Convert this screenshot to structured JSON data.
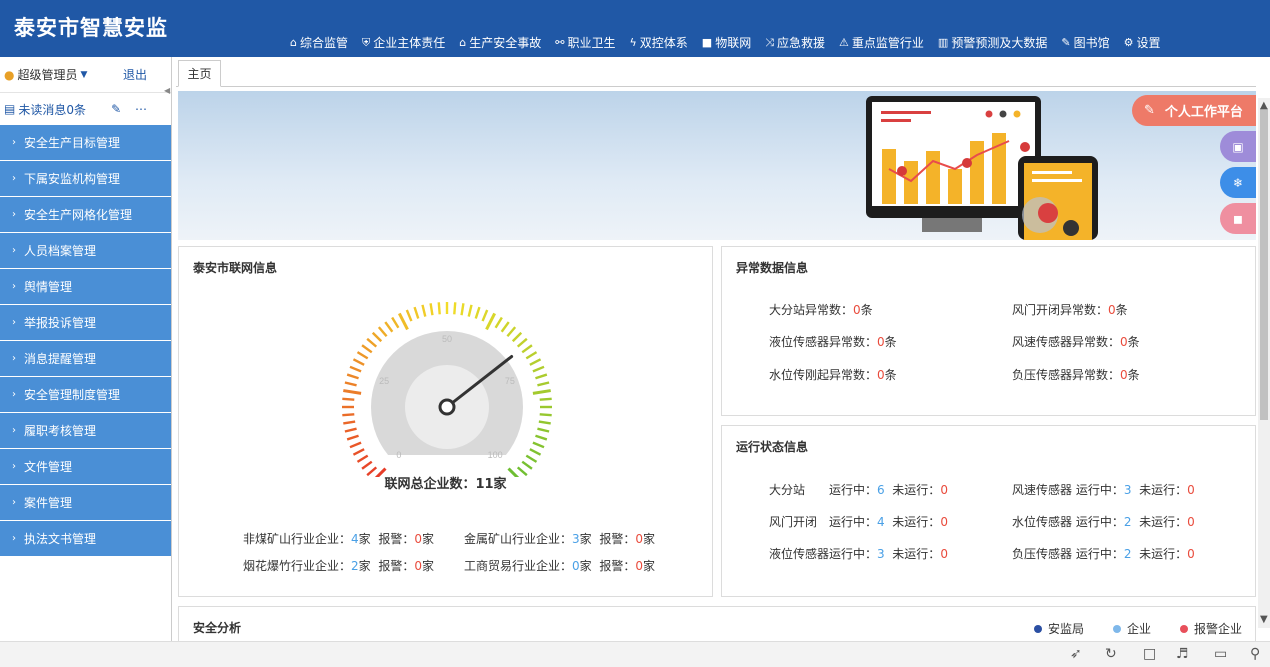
{
  "app": {
    "title": "泰安市智慧安监"
  },
  "nav": [
    {
      "icon": "home-icon",
      "glyph": "⌂",
      "label": "综合监管"
    },
    {
      "icon": "shield-icon",
      "glyph": "⛨",
      "label": "企业主体责任"
    },
    {
      "icon": "bank-icon",
      "glyph": "⌂",
      "label": "生产安全事故"
    },
    {
      "icon": "sitemap-icon",
      "glyph": "⚯",
      "label": "职业卫生"
    },
    {
      "icon": "bolt-icon",
      "glyph": "ϟ",
      "label": "双控体系"
    },
    {
      "icon": "camera-icon",
      "glyph": "■",
      "label": "物联网"
    },
    {
      "icon": "shuffle-icon",
      "glyph": "⤨",
      "label": "应急救援"
    },
    {
      "icon": "warning-icon",
      "glyph": "⚠",
      "label": "重点监管行业"
    },
    {
      "icon": "bar-chart-icon",
      "glyph": "▥",
      "label": "预警预测及大数据"
    },
    {
      "icon": "wrench-icon",
      "glyph": "✎",
      "label": "图书馆"
    },
    {
      "icon": "gear-icon",
      "glyph": "⚙",
      "label": "设置"
    }
  ],
  "sidebar": {
    "user": "超级管理员",
    "logout": "退出",
    "unread": "未读消息0条",
    "items": [
      "安全生产目标管理",
      "下属安监机构管理",
      "安全生产网格化管理",
      "人员档案管理",
      "舆情管理",
      "举报投诉管理",
      "消息提醒管理",
      "安全管理制度管理",
      "履职考核管理",
      "文件管理",
      "案件管理",
      "执法文书管理"
    ]
  },
  "tabs": {
    "home": "主页"
  },
  "float": {
    "workbench": "个人工作平台"
  },
  "network": {
    "title": "泰安市联网信息",
    "gauge": {
      "value": 11,
      "min": 0,
      "max": 100,
      "ticks": [
        "0",
        "25",
        "50",
        "75",
        "100"
      ]
    },
    "total_label": "联网总企业数：11家",
    "rows": [
      {
        "label": "非煤矿山行业企业：",
        "count": "4",
        "unit": "家",
        "alarm_label": "报警：",
        "alarm": "0",
        "alarm_unit": "家"
      },
      {
        "label": "金属矿山行业企业：",
        "count": "3",
        "unit": "家",
        "alarm_label": "报警：",
        "alarm": "0",
        "alarm_unit": "家"
      },
      {
        "label": "烟花爆竹行业企业：",
        "count": "2",
        "unit": "家",
        "alarm_label": "报警：",
        "alarm": "0",
        "alarm_unit": "家"
      },
      {
        "label": "工商贸易行业企业：",
        "count": "0",
        "unit": "家",
        "alarm_label": "报警：",
        "alarm": "0",
        "alarm_unit": "家"
      }
    ]
  },
  "abnormal": {
    "title": "异常数据信息",
    "items": [
      {
        "label": "大分站异常数：",
        "value": "0",
        "unit": "条"
      },
      {
        "label": "风门开闭异常数：",
        "value": "0",
        "unit": "条"
      },
      {
        "label": "液位传感器异常数：",
        "value": "0",
        "unit": "条"
      },
      {
        "label": "风速传感器异常数：",
        "value": "0",
        "unit": "条"
      },
      {
        "label": "水位传刚起异常数：",
        "value": "0",
        "unit": "条"
      },
      {
        "label": "负压传感器异常数：",
        "value": "0",
        "unit": "条"
      }
    ]
  },
  "status": {
    "title": "运行状态信息",
    "running_label": "运行中：",
    "stopped_label": "未运行：",
    "items": [
      {
        "name": "大分站",
        "running": "6",
        "stopped": "0"
      },
      {
        "name": "风速传感器",
        "running": "3",
        "stopped": "0"
      },
      {
        "name": "风门开闭",
        "running": "4",
        "stopped": "0"
      },
      {
        "name": "水位传感器",
        "running": "2",
        "stopped": "0"
      },
      {
        "name": "液位传感器",
        "running": "3",
        "stopped": "0"
      },
      {
        "name": "负压传感器",
        "running": "2",
        "stopped": "0"
      }
    ]
  },
  "analysis": {
    "title": "安全分析",
    "legend": [
      {
        "name": "安监局",
        "color": "#2b4fa3"
      },
      {
        "name": "企业",
        "color": "#7fb8ea"
      },
      {
        "name": "报警企业",
        "color": "#e8505b"
      }
    ]
  },
  "colors": {
    "brand": "#2058a6",
    "menu": "#4a8fd6",
    "alert": "#e94b3c",
    "count": "#4aa0e6"
  }
}
